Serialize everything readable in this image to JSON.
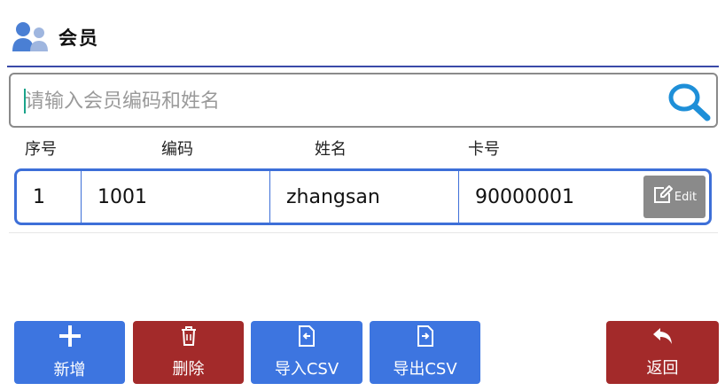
{
  "header": {
    "title": "会员"
  },
  "search": {
    "placeholder": "请输入会员编码和姓名",
    "value": ""
  },
  "columns": {
    "index": "序号",
    "code": "编码",
    "name": "姓名",
    "card": "卡号"
  },
  "rows": [
    {
      "index": "1",
      "code": "1001",
      "name": "zhangsan",
      "card": "90000001",
      "edit_label": "Edit"
    }
  ],
  "footer": {
    "add_label": "新增",
    "delete_label": "删除",
    "import_label": "导入CSV",
    "export_label": "导出CSV",
    "back_label": "返回"
  },
  "colors": {
    "accent_blue": "#3d75e0",
    "danger_red": "#a32a2a",
    "row_border": "#3d6fd8",
    "edit_gray": "#8a8a8a"
  },
  "icons": [
    "members-icon",
    "search-icon",
    "edit-icon",
    "plus-icon",
    "trash-icon",
    "import-file-icon",
    "export-file-icon",
    "back-arrow-icon"
  ]
}
